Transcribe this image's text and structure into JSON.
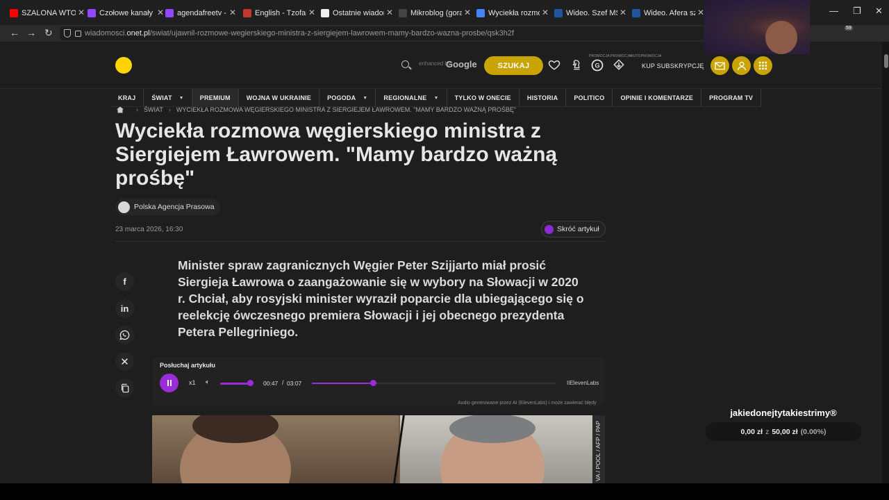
{
  "tabs": [
    {
      "title": "SZALONA WTORE",
      "color": "#ff0000",
      "glyph": "▶"
    },
    {
      "title": "Czołowe kanały -",
      "color": "#9146ff",
      "glyph": "t"
    },
    {
      "title": "agendafreetv - Tw",
      "color": "#9146ff",
      "glyph": "t"
    },
    {
      "title": "English - Tzofar -",
      "color": "#c0392b",
      "glyph": "●"
    },
    {
      "title": "Ostatnie wiadom",
      "color": "#eeeeee",
      "glyph": "w"
    },
    {
      "title": "Mikroblog (gorąc",
      "color": "#444444",
      "glyph": "M"
    },
    {
      "title": "Wyciekła rozmow",
      "color": "#4285f4",
      "glyph": "G"
    },
    {
      "title": "Wideo. Szef MSZ",
      "color": "#1e56a0",
      "glyph": "on"
    },
    {
      "title": "Wideo. Afera szpi",
      "color": "#1e56a0",
      "glyph": "on"
    }
  ],
  "url": {
    "prefix": "wiadomosci.",
    "domain": "onet.pl",
    "path": "/swiat/ujawnil-rozmowe-wegierskiego-ministra-z-siergiejem-lawrowem-mamy-bardzo-wazna-prosbe/qsk3h2f"
  },
  "extension_badge": "59",
  "header": {
    "enhanced_by": "enhanced by",
    "google": "Google",
    "search_button": "SZUKAJ",
    "promo_labels": [
      "PROMOCJA",
      "PROMOCJA",
      "AUTOPROMOCJA"
    ],
    "subscribe": "KUP SUBSKRYPCJĘ"
  },
  "nav": [
    {
      "label": "KRAJ",
      "caret": false
    },
    {
      "label": "ŚWIAT",
      "caret": true
    },
    {
      "label": "PREMIUM",
      "caret": false
    },
    {
      "label": "WOJNA W UKRAINIE",
      "caret": false
    },
    {
      "label": "POGODA",
      "caret": true
    },
    {
      "label": "REGIONALNE",
      "caret": true
    },
    {
      "label": "TYLKO W ONECIE",
      "caret": false
    },
    {
      "label": "HISTORIA",
      "caret": false
    },
    {
      "label": "POLITICO",
      "caret": false
    },
    {
      "label": "OPINIE I KOMENTARZE",
      "caret": false
    },
    {
      "label": "PROGRAM TV",
      "caret": false
    }
  ],
  "breadcrumb": {
    "section": "ŚWIAT",
    "current": "WYCIEKŁA ROZMOWA WĘGIERSKIEGO MINISTRA Z SIERGIEJEM ŁAWROWEM. \"MAMY BARDZO WAŻNĄ PROŚBĘ\""
  },
  "article": {
    "title": "Wyciekła rozmowa węgierskiego ministra z Siergiejem Ławrowem. \"Mamy bardzo ważną prośbę\"",
    "author": "Polska Agencja Prasowa",
    "date": "23 marca 2026, 16:30",
    "shorten": "Skróć artykuł",
    "lead": "Minister spraw zagranicznych Węgier Peter Szijjarto miał prosić Siergieja Ławrowa o zaangażowanie się w wybory na Słowacji w 2020 r. Chciał, aby rosyjski minister wyraził poparcie dla ubiegającego się o reelekcję ówczesnego premiera Słowacji i jej obecnego prezydenta Petera Pellegriniego.",
    "photo_credit": "VA / POOL / AFP / PAP"
  },
  "share_icons": [
    "facebook-icon",
    "linkedin-icon",
    "whatsapp-icon",
    "x-icon",
    "copy-icon"
  ],
  "player": {
    "title": "Posłuchaj artykułu",
    "speed": "x1",
    "current": "00:47",
    "separator": "/",
    "total": "03:07",
    "progress": 0.25,
    "volume": 1.0,
    "brand": "IIElevenLabs",
    "note": "Audio generowane przez AI (ElevenLabs) i może zawierać błędy"
  },
  "overlay": {
    "name": "jakiedonejtytakiestrimy®",
    "current": "0,00 zł",
    "of": "z",
    "goal": "50,00 zł",
    "percent": "(0.00%)"
  },
  "colors": {
    "accent": "#9b2dd9",
    "brand": "#ffd400",
    "button": "#c9a400"
  }
}
